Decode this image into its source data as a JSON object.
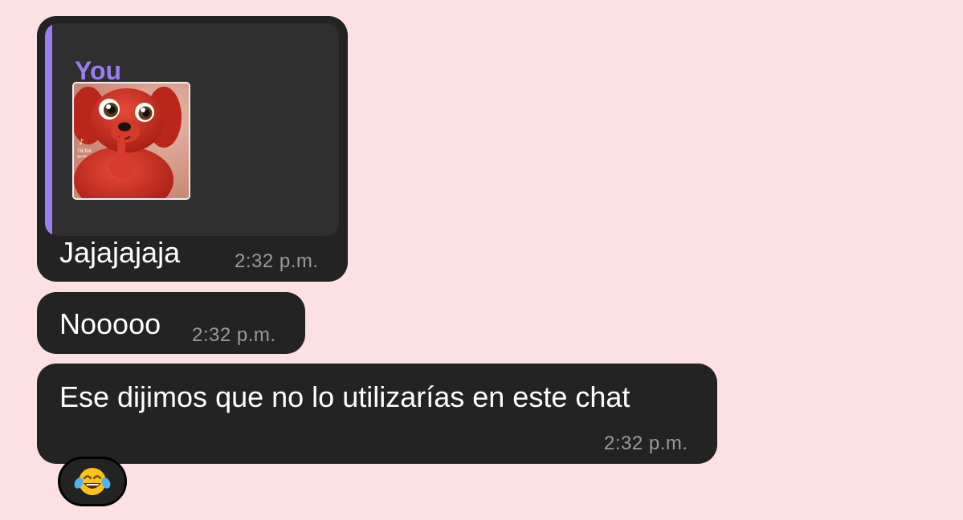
{
  "colors": {
    "background": "#fde0e3",
    "bubble": "#232323",
    "quote_background": "#2f2f2f",
    "quote_accent": "#9b7df2",
    "message_text": "#ffffff",
    "timestamp": "#9a9a9a"
  },
  "messages": [
    {
      "reply_to": {
        "author": "You",
        "media": {
          "type": "image",
          "description_icon": "red-cartoon-dog-sticker",
          "watermark": "TikTok"
        }
      },
      "text": "Jajajajaja",
      "time": "2:32 p.m."
    },
    {
      "text": "Nooooo",
      "time": "2:32 p.m."
    },
    {
      "text": "Ese dijimos que no lo utilizarías en este chat",
      "time": "2:32 p.m.",
      "reaction": {
        "emoji": "😂",
        "icon": "face-with-tears-of-joy-icon"
      }
    }
  ]
}
